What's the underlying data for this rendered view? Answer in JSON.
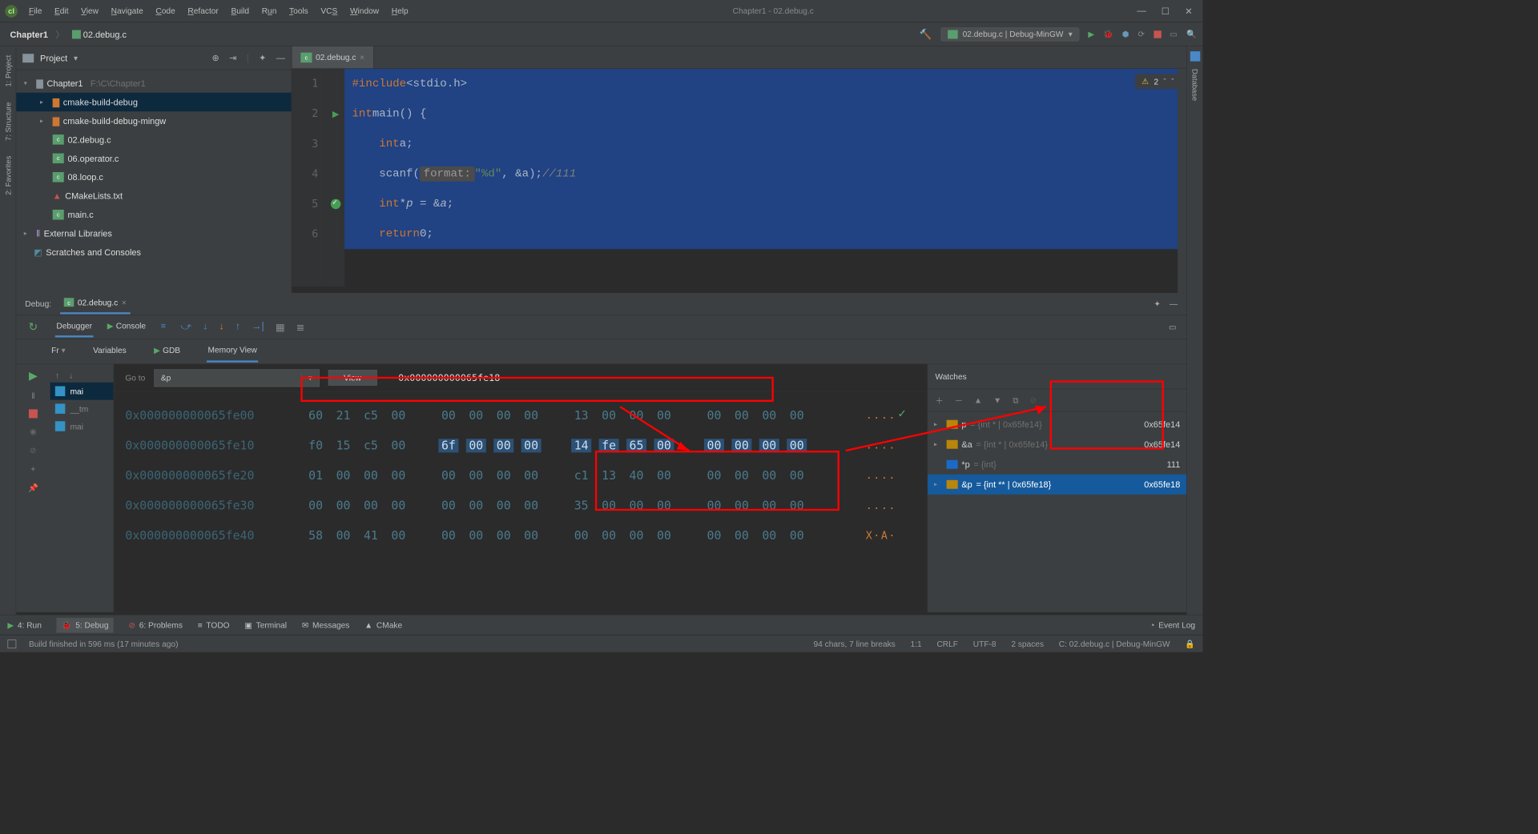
{
  "window": {
    "title": "Chapter1 - 02.debug.c"
  },
  "menu": [
    "File",
    "Edit",
    "View",
    "Navigate",
    "Code",
    "Refactor",
    "Build",
    "Run",
    "Tools",
    "VCS",
    "Window",
    "Help"
  ],
  "breadcrumb": {
    "project": "Chapter1",
    "file": "02.debug.c"
  },
  "runconfig": "02.debug.c | Debug-MinGW",
  "project_head": "Project",
  "tree": {
    "root": {
      "name": "Chapter1",
      "path": "F:\\C\\Chapter1"
    },
    "items": [
      {
        "name": "cmake-build-debug",
        "type": "folder"
      },
      {
        "name": "cmake-build-debug-mingw",
        "type": "folder"
      },
      {
        "name": "02.debug.c",
        "type": "c"
      },
      {
        "name": "06.operator.c",
        "type": "c"
      },
      {
        "name": "08.loop.c",
        "type": "c"
      },
      {
        "name": "CMakeLists.txt",
        "type": "txt"
      },
      {
        "name": "main.c",
        "type": "c"
      }
    ],
    "ext_lib": "External Libraries",
    "scratch": "Scratches and Consoles"
  },
  "editor": {
    "tab": "02.debug.c",
    "warn_count": "2",
    "lines": [
      {
        "n": "1",
        "raw": "#include <stdio.h>"
      },
      {
        "n": "2",
        "raw": "int main() {"
      },
      {
        "n": "3",
        "raw": "    int a;"
      },
      {
        "n": "4",
        "raw": "    scanf( format: \"%d\", &a);//111"
      },
      {
        "n": "5",
        "raw": "    int *p = &a;"
      },
      {
        "n": "6",
        "raw": "    return 0;"
      }
    ]
  },
  "debug": {
    "label": "Debug:",
    "tab": "02.debug.c",
    "subtabs": {
      "debugger": "Debugger",
      "console": "Console"
    },
    "subsub": {
      "fr": "Fr",
      "variables": "Variables",
      "gdb": "GDB",
      "mem": "Memory View"
    },
    "frames": {
      "main": "mai",
      "tm": "__tm",
      "main2": "mai"
    },
    "memory": {
      "goto_label": "Go to",
      "goto_value": "&p",
      "view_btn": "View",
      "address": "0x000000000065fe18",
      "rows": [
        {
          "addr": "0x000000000065fe00",
          "b": [
            "60",
            "21",
            "c5",
            "00",
            "00",
            "00",
            "00",
            "00",
            "13",
            "00",
            "00",
            "00",
            "00",
            "00",
            "00",
            "00"
          ],
          "asc": "...."
        },
        {
          "addr": "0x000000000065fe10",
          "b": [
            "f0",
            "15",
            "c5",
            "00",
            "6f",
            "00",
            "00",
            "00",
            "14",
            "fe",
            "65",
            "00",
            "00",
            "00",
            "00",
            "00"
          ],
          "asc": "...."
        },
        {
          "addr": "0x000000000065fe20",
          "b": [
            "01",
            "00",
            "00",
            "00",
            "00",
            "00",
            "00",
            "00",
            "c1",
            "13",
            "40",
            "00",
            "00",
            "00",
            "00",
            "00"
          ],
          "asc": "...."
        },
        {
          "addr": "0x000000000065fe30",
          "b": [
            "00",
            "00",
            "00",
            "00",
            "00",
            "00",
            "00",
            "00",
            "35",
            "00",
            "00",
            "00",
            "00",
            "00",
            "00",
            "00"
          ],
          "asc": "...."
        },
        {
          "addr": "0x000000000065fe40",
          "b": [
            "58",
            "00",
            "41",
            "00",
            "00",
            "00",
            "00",
            "00",
            "00",
            "00",
            "00",
            "00",
            "00",
            "00",
            "00",
            "00"
          ],
          "asc": "X·A·"
        }
      ]
    },
    "watches": {
      "title": "Watches",
      "rows": [
        {
          "name": "p",
          "type": "= {int * | 0x65fe14}",
          "val": "0x65fe14"
        },
        {
          "name": "&a",
          "type": "= {int * | 0x65fe14}",
          "val": "0x65fe14"
        },
        {
          "name": "*p",
          "type": "= {int}",
          "val": "111"
        },
        {
          "name": "&p",
          "type": "= {int ** | 0x65fe18}",
          "val": "0x65fe18"
        }
      ]
    }
  },
  "bottombar": {
    "run": "4: Run",
    "debug": "5: Debug",
    "problems": "6: Problems",
    "todo": "TODO",
    "terminal": "Terminal",
    "messages": "Messages",
    "cmake": "CMake",
    "eventlog": "Event Log"
  },
  "status": {
    "build": "Build finished in 596 ms (17 minutes ago)",
    "chars": "94 chars, 7 line breaks",
    "pos": "1:1",
    "eol": "CRLF",
    "enc": "UTF-8",
    "indent": "2 spaces",
    "ctx": "C: 02.debug.c | Debug-MinGW"
  },
  "sidetabs": {
    "project": "1: Project",
    "structure": "7: Structure",
    "favorites": "2: Favorites",
    "database": "Database"
  }
}
